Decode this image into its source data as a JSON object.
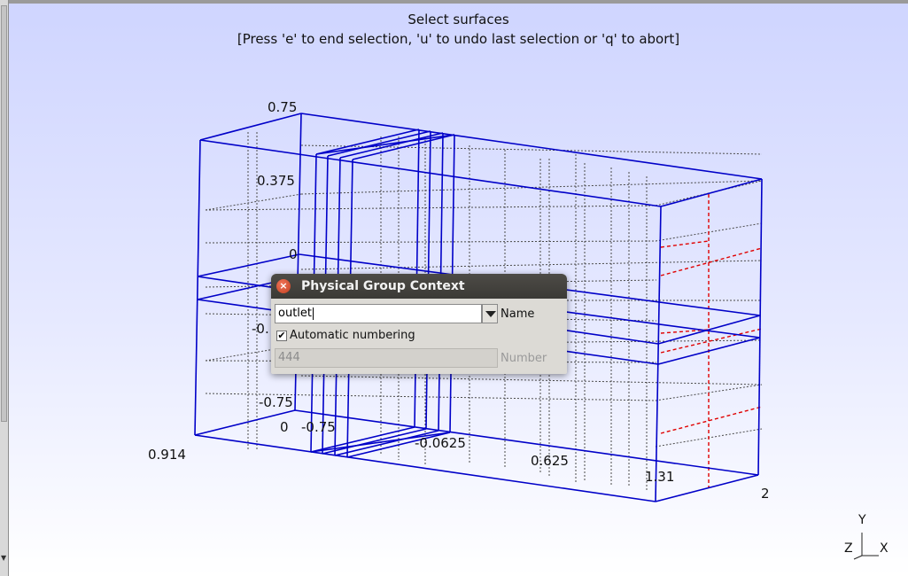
{
  "viewport": {
    "message_line1": "Select surfaces",
    "message_line2": "[Press 'e' to end selection, 'u' to undo last selection or 'q' to abort]",
    "axis_labels": {
      "y_top": "0.75",
      "y_mid_upper": "0.375",
      "y_zero": "0",
      "y_mid_lower": "-0.",
      "y_bottom": "-0.75",
      "z_start": "0",
      "z_end": "-0.75",
      "x_corner": "0.914",
      "x_a": "-0.0625",
      "x_b": "0.625",
      "x_c": "1.31",
      "x_end": "2"
    },
    "triad": {
      "y": "Y",
      "z": "Z",
      "x": "X"
    },
    "colors": {
      "background_top": "#cfd5ff",
      "background_bottom": "#ffffff",
      "edge_blue": "#0000c8",
      "selected_red": "#e00000",
      "dotted_gray": "#555555"
    }
  },
  "dialog": {
    "title": "Physical Group Context",
    "close_icon": "close-icon",
    "name_value": "outlet",
    "name_label": "Name",
    "auto_numbering_label": "Automatic numbering",
    "auto_numbering_checked": true,
    "check_mark": "✔",
    "number_value": "444",
    "number_label": "Number"
  }
}
